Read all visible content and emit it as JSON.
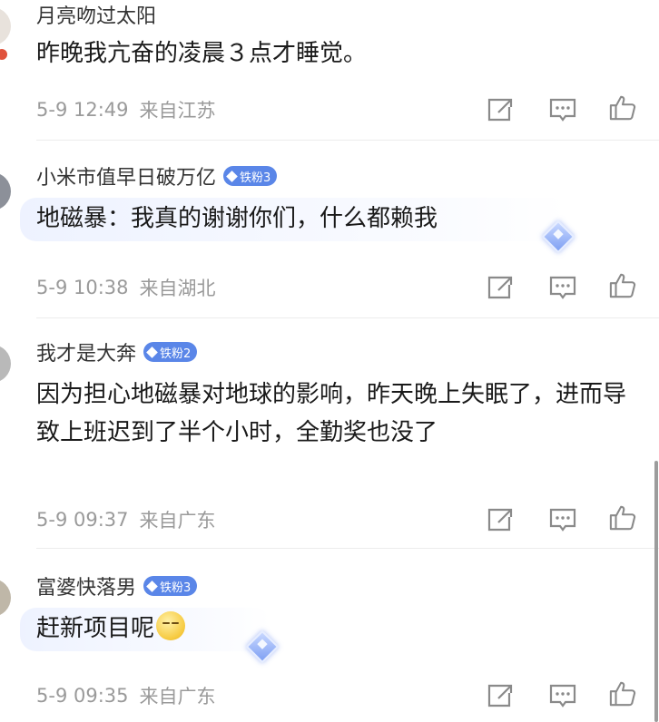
{
  "comments": [
    {
      "username": "月亮吻过太阳",
      "text": "昨晚我亢奋的凌晨３点才睡觉。",
      "timestamp": "5-9 12:49",
      "location": "来自江苏"
    },
    {
      "username": "小米市值早日破万亿",
      "fan_badge": "铁粉3",
      "text": "地磁暴：我真的谢谢你们，什么都赖我",
      "timestamp": "5-9 10:38",
      "location": "来自湖北"
    },
    {
      "username": "我才是大奔",
      "fan_badge": "铁粉2",
      "text": "因为担心地磁暴对地球的影响，昨天晚上失眠了，进而导致上班迟到了半个小时，全勤奖也没了",
      "timestamp": "5-9 09:37",
      "location": "来自广东"
    },
    {
      "username": "富婆快落男",
      "fan_badge": "铁粉3",
      "text": "赶新项目呢",
      "timestamp": "5-9 09:35",
      "location": "来自广东"
    }
  ],
  "icons": {
    "repost": "repost-icon",
    "comment": "comment-icon",
    "like": "like-icon"
  },
  "colors": {
    "fan_badge": "#5a86e8",
    "meta_text": "#9a9a9a",
    "icon_stroke": "#8a8a8a"
  }
}
